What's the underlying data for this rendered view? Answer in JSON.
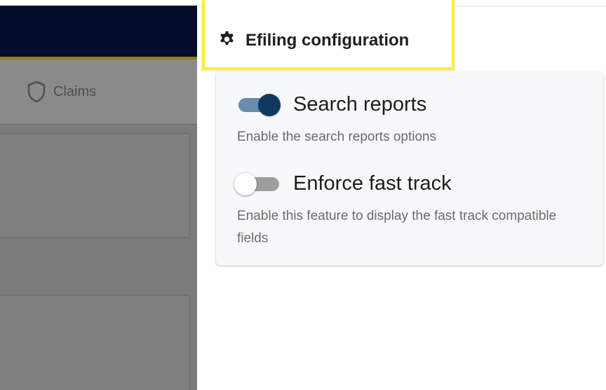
{
  "background": {
    "nav": {
      "claims_tab_label": "Claims"
    }
  },
  "drawer": {
    "title": "Efiling configuration",
    "settings": [
      {
        "label": "Search reports",
        "enabled": true,
        "description": "Enable the search reports options"
      },
      {
        "label": "Enforce fast track",
        "enabled": false,
        "description": "Enable this feature to display the fast track compatible fields"
      }
    ]
  },
  "colors": {
    "header_navy": "#050c2c",
    "header_gold_line": "#8d7a1e",
    "highlight_yellow": "#f3f330",
    "toggle_on_thumb": "#0f3a5f",
    "toggle_on_track": "#6a8cae",
    "toggle_off_track": "#9e9e9e"
  }
}
